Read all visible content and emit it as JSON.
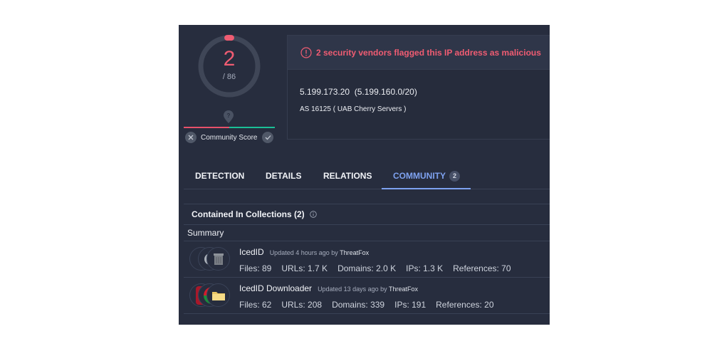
{
  "score": {
    "detections": "2",
    "total": "/ 86",
    "detection_fraction": 0.0233,
    "community_score_label": "Community Score",
    "community_score_balance": 0.5,
    "colors": {
      "malicious": "#f05c72",
      "harmless": "#1bbf96",
      "ring": "#3f4657"
    }
  },
  "card": {
    "alert": "2 security vendors flagged this IP address as malicious",
    "ip": "5.199.173.20",
    "network": "(5.199.160.0/20)",
    "as_info": "AS 16125 ( UAB Cherry Servers )"
  },
  "tabs": [
    {
      "label": "DETECTION",
      "active": false
    },
    {
      "label": "DETAILS",
      "active": false
    },
    {
      "label": "RELATIONS",
      "active": false
    },
    {
      "label": "COMMUNITY",
      "active": true,
      "badge": "2"
    }
  ],
  "collections": {
    "title": "Contained In Collections",
    "count": "(2)",
    "summary_label": "Summary",
    "items": [
      {
        "name": "IcedID",
        "updated": "Updated 4 hours ago by",
        "author": "ThreatFox",
        "icons": [
          "document-icon",
          "moon-icon",
          "trash-icon"
        ],
        "stats": [
          "Files: 89",
          "URLs: 1.7 K",
          "Domains: 2.0 K",
          "IPs: 1.3 K",
          "References: 70"
        ]
      },
      {
        "name": "IcedID Downloader",
        "updated": "Updated 13 days ago by",
        "author": "ThreatFox",
        "icons": [
          "red-icon",
          "red-green-icon",
          "folder-icon"
        ],
        "stats": [
          "Files: 62",
          "URLs: 208",
          "Domains: 339",
          "IPs: 191",
          "References: 20"
        ]
      }
    ]
  }
}
